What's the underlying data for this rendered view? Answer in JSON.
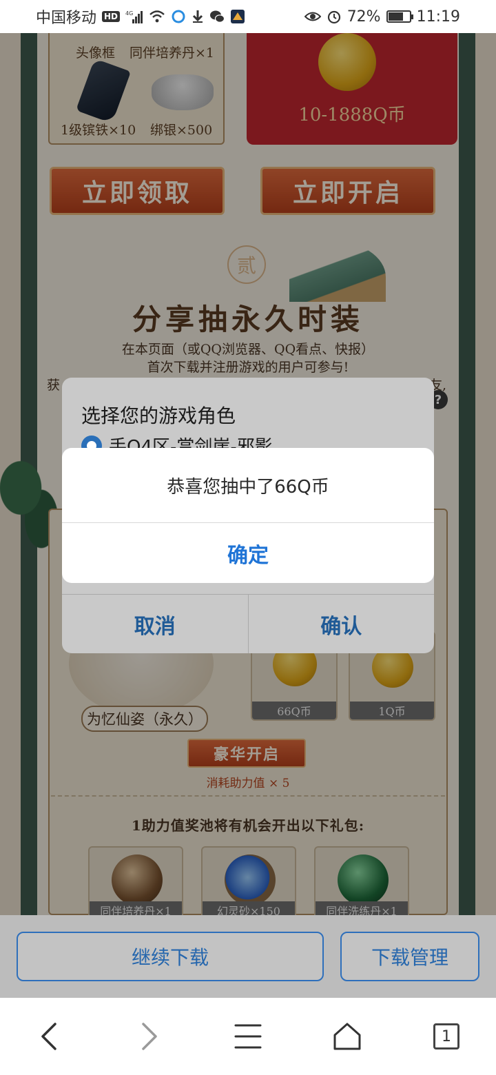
{
  "status_bar": {
    "carrier": "中国移动",
    "hd": "HD",
    "network": "4G",
    "battery": "72%",
    "battery_level": 0.72,
    "time": "11:19"
  },
  "page": {
    "rewards": {
      "avatar_frame": "头像框",
      "companion_pill": "同伴培养丹×1",
      "iron": "1级镔铁×10",
      "silver": "绑银×500",
      "red_packet": "10-1888Q币"
    },
    "claim_button": "立即领取",
    "open_button": "立即开启",
    "section_seal": "贰",
    "section_title": "分享抽永久时装",
    "section_desc_1": "在本页面（或QQ浏览器、QQ看点、快报）",
    "section_desc_2": "首次下载并注册游戏的用户可参与!",
    "section_desc_3_left": "获",
    "section_desc_3_right": "友,",
    "help_icon": "?",
    "costume_label": "为忆仙姿（永久）",
    "prize_66": "66Q币",
    "prize_1": "1Q币",
    "luxury_open": "豪华开启",
    "consume_text": "消耗助力值 × 5",
    "pool_text": "1助力值奖池将有机会开出以下礼包:",
    "pool_items": [
      "同伴培养丹×1",
      "幻灵砂×150",
      "同伴洗练丹×1"
    ]
  },
  "role_dialog": {
    "title": "选择您的游戏角色",
    "option": "手Q4区-赏剑崖-邪影",
    "cancel": "取消",
    "confirm": "确认"
  },
  "alert": {
    "message": "恭喜您抽中了66Q币",
    "ok": "确定"
  },
  "download_bar": {
    "continue": "继续下载",
    "manage": "下载管理"
  },
  "nav": {
    "tab_count": "1"
  },
  "colors": {
    "accent_blue": "#1f74d6",
    "dialog_blue": "#1f5a96",
    "orange_button": "#c9512a",
    "red_packet": "#c0262f"
  }
}
